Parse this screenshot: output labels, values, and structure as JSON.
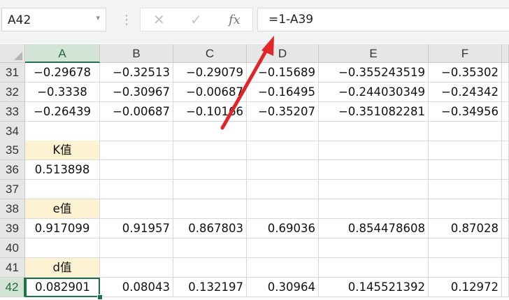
{
  "formula_bar": {
    "name_box": "A42",
    "dropdown_glyph": "▾",
    "separator": "⋮",
    "cancel_glyph": "✕",
    "enter_glyph": "✓",
    "fx_label": "fx",
    "formula": "=1-A39"
  },
  "columns": [
    "A",
    "B",
    "C",
    "D",
    "E",
    "F"
  ],
  "rows": [
    {
      "num": "31",
      "cells": [
        "−0.29678",
        "−0.32513",
        "−0.29079",
        "−0.15689",
        "−0.355243519",
        "−0.35302"
      ]
    },
    {
      "num": "32",
      "cells": [
        "−0.3338",
        "−0.30967",
        "−0.00687",
        "−0.16495",
        "−0.244030349",
        "−0.24342"
      ]
    },
    {
      "num": "33",
      "cells": [
        "−0.26439",
        "−0.00687",
        "−0.10166",
        "−0.35207",
        "−0.351082281",
        "−0.34956"
      ]
    },
    {
      "num": "34",
      "cells": [
        "",
        "",
        "",
        "",
        "",
        ""
      ]
    },
    {
      "num": "35",
      "cells": [
        "K值",
        "",
        "",
        "",
        "",
        ""
      ]
    },
    {
      "num": "36",
      "cells": [
        "0.513898",
        "",
        "",
        "",
        "",
        ""
      ]
    },
    {
      "num": "37",
      "cells": [
        "",
        "",
        "",
        "",
        "",
        ""
      ]
    },
    {
      "num": "38",
      "cells": [
        "e值",
        "",
        "",
        "",
        "",
        ""
      ]
    },
    {
      "num": "39",
      "cells": [
        "0.917099",
        "0.91957",
        "0.867803",
        "0.69036",
        "0.854478608",
        "0.87028"
      ]
    },
    {
      "num": "40",
      "cells": [
        "",
        "",
        "",
        "",
        "",
        ""
      ]
    },
    {
      "num": "41",
      "cells": [
        "d值",
        "",
        "",
        "",
        "",
        ""
      ]
    },
    {
      "num": "42",
      "cells": [
        "0.082901",
        "0.08043",
        "0.132197",
        "0.30964",
        "0.145521392",
        "0.12972"
      ]
    }
  ],
  "colors": {
    "accent": "#1e7145",
    "label_fill": "#fdf2d1",
    "annotation_arrow": "#e0252b"
  }
}
